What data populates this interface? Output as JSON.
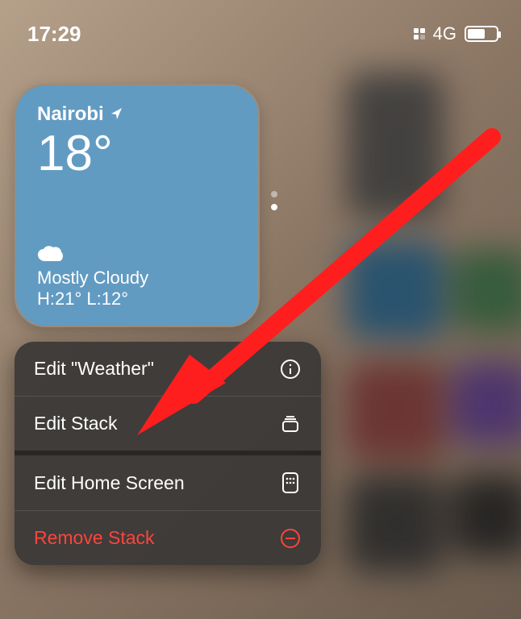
{
  "status_bar": {
    "time": "17:29",
    "network_label": "4G"
  },
  "widget": {
    "city": "Nairobi",
    "temperature": "18°",
    "condition": "Mostly Cloudy",
    "hilo": "H:21° L:12°",
    "location_icon": "location-arrow-icon",
    "weather_icon": "cloud-icon"
  },
  "menu": {
    "items": [
      {
        "label": "Edit \"Weather\"",
        "icon": "info-icon",
        "destructive": false
      },
      {
        "label": "Edit Stack",
        "icon": "stack-icon",
        "destructive": false
      },
      {
        "label": "Edit Home Screen",
        "icon": "phone-grid-icon",
        "destructive": false,
        "group_after": true
      },
      {
        "label": "Remove Stack",
        "icon": "minus-circle-icon",
        "destructive": true
      }
    ]
  },
  "annotation": {
    "arrow_color": "#ff1e1e"
  }
}
